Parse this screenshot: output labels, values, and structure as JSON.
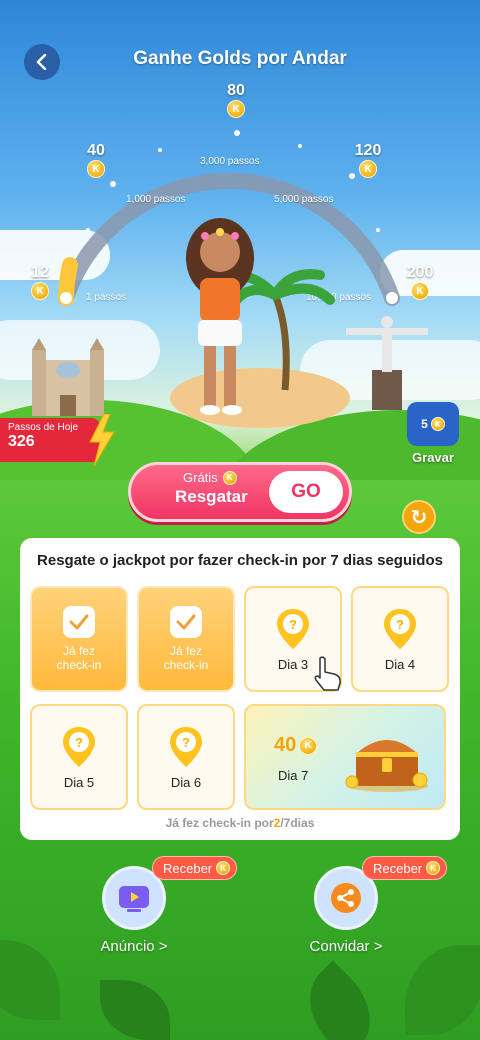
{
  "header": {
    "title": "Ganhe Golds por Andar",
    "back_icon": "chevron-left-icon"
  },
  "milestones": [
    {
      "reward": "12",
      "steps": "1 passos"
    },
    {
      "reward": "40",
      "steps": "1,000 passos"
    },
    {
      "reward": "80",
      "steps": "3,000 passos"
    },
    {
      "reward": "120",
      "steps": "5,000 passos"
    },
    {
      "reward": "200",
      "steps": "10,000 passos"
    }
  ],
  "coin_symbol": "K",
  "today_steps": {
    "label": "Passos de Hoje",
    "value": "326"
  },
  "video": {
    "count": "5",
    "label": "Gravar"
  },
  "claim": {
    "free_label": "Grátis",
    "label": "Resgatar",
    "go": "GO"
  },
  "checkin": {
    "title": "Resgate o jackpot por fazer check-in por 7 dias seguidos",
    "done_label_1": "Já fez",
    "done_label_2": "check-in",
    "days": [
      "Dia 3",
      "Dia 4",
      "Dia 5",
      "Dia 6",
      "Dia 7"
    ],
    "jackpot_amount": "40",
    "progress_prefix": "Já fez check-in por",
    "progress_current": "2",
    "progress_suffix": "/7dias"
  },
  "actions": [
    {
      "label": "Anúncio >",
      "badge": "Receber",
      "icon": "video-play-icon"
    },
    {
      "label": "Convidar >",
      "badge": "Receber",
      "icon": "share-icon"
    }
  ],
  "colors": {
    "accent": "#f03564",
    "gold": "#f5a50e",
    "badge_red": "#e4283b",
    "sky": "#2e86d8",
    "grass": "#3fb82a"
  }
}
